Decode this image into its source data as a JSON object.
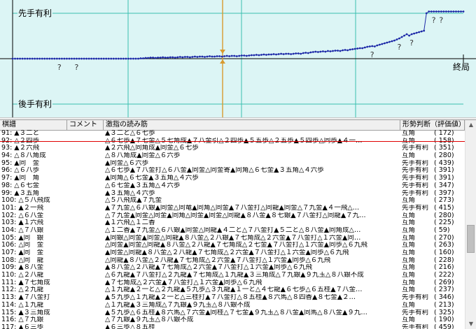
{
  "graph": {
    "label_top": "先手有利",
    "label_bottom": "後手有利",
    "label_end": "終局",
    "question_mark": "?",
    "grid_color": "#3ac0b0",
    "cursor_color": "#d89a30",
    "line_color": "#1e2aa8",
    "zero_line_color": "#000000",
    "background": "#dcf5f5",
    "eval_series": [
      0,
      0,
      0,
      0,
      0,
      0,
      0,
      0,
      0,
      0,
      0,
      0,
      0,
      0,
      0,
      0,
      0,
      0,
      0,
      0,
      0,
      0,
      0,
      0,
      0,
      0,
      0,
      0,
      0,
      0,
      0,
      0,
      0,
      0,
      0,
      0,
      0,
      0,
      0,
      0,
      0,
      0,
      0,
      0,
      0,
      0,
      0,
      0,
      0,
      0,
      0,
      0,
      1,
      1,
      2,
      2,
      3,
      3,
      2,
      3,
      3,
      4,
      3,
      3,
      4,
      4,
      3,
      4,
      5,
      4,
      5,
      5,
      4,
      5,
      6,
      5,
      6,
      6,
      5,
      6,
      7,
      6,
      6,
      7,
      7,
      6,
      7,
      8,
      7,
      8,
      8,
      7,
      8,
      9,
      9,
      8,
      9,
      10,
      10,
      11,
      10,
      11,
      12,
      11,
      12,
      12,
      13,
      12,
      13,
      14,
      13,
      14,
      14,
      13,
      14,
      15,
      15,
      14,
      16,
      17,
      16,
      18,
      19,
      20,
      19,
      20,
      21,
      20,
      22,
      21,
      22,
      23,
      23,
      22,
      24,
      25,
      24,
      26,
      27,
      28,
      29,
      30,
      30,
      32,
      34,
      35,
      36,
      35,
      38,
      40,
      42,
      44,
      46,
      48,
      50,
      52,
      55,
      58,
      62,
      66,
      70,
      66,
      70,
      72,
      74,
      76,
      78,
      80,
      130,
      135,
      135,
      135,
      135,
      135,
      135,
      135,
      135,
      135,
      135,
      135,
      135,
      135,
      135,
      135
    ],
    "question_marks_at": [
      19,
      26,
      146,
      157,
      162,
      171,
      174
    ]
  },
  "list": {
    "headers": [
      "棋譜",
      "コメント",
      "激指の読み筋",
      "形勢判断（評価値）"
    ],
    "rows": [
      {
        "move": "91: ▲３二と",
        "pv": "▲３二と△６七歩",
        "judge": "互角",
        "val": "(    172)"
      },
      {
        "move": "92: △２四歩",
        "pv": "△６七歩▲７七金△５七角成▲７八金引△２四歩▲５五歩△２五歩▲５四歩△同歩▲４一…",
        "judge": "互角",
        "val": "(    158)"
      },
      {
        "move": "93: ▲２六飛",
        "pv": "▲２六飛△同角成▲同金△６七歩",
        "judge": "先手有利",
        "val": "(    351)"
      },
      {
        "move": "94: △８八角成",
        "pv": "△８八角成▲同金△６六歩",
        "judge": "互角",
        "val": "(    280)"
      },
      {
        "move": "95: ▲同　金",
        "pv": "▲同金△６六歩",
        "judge": "先手有利",
        "val": "(    439)"
      },
      {
        "move": "96: △６八歩",
        "pv": "△６七歩▲７八金打△６八金▲同金△同金寄▲同角△６七金▲３五角△４六歩",
        "judge": "先手有利",
        "val": "(    391)"
      },
      {
        "move": "97: ▲同　角",
        "pv": "▲同角△６七金▲３五角△４六歩",
        "judge": "先手有利",
        "val": "(    391)"
      },
      {
        "move": "98: △６七金",
        "pv": "△６七金▲３五角△４六歩",
        "judge": "先手有利",
        "val": "(    347)"
      },
      {
        "move": "99: ▲３五角",
        "pv": "▲３五角△４六歩",
        "judge": "先手有利",
        "val": "(    397)"
      },
      {
        "move": "100: △５八飛成",
        "pv": "△５八飛成▲７九金",
        "judge": "互角",
        "val": "(    273)"
      },
      {
        "move": "101: ▲２一飛",
        "pv": "▲７九金△６八銀▲同金△同竜▲同角△同金▲７八金打△同龍▲同金△７九金▲４一飛△…",
        "judge": "先手有利",
        "val": "(    415)"
      },
      {
        "move": "102: △６八金",
        "pv": "△７九金▲同金△同金▲同角△同金▲同金△同龍▲８八金▲８七銀▲７八金打△同龍▲７九…",
        "judge": "互角",
        "val": "(    280)"
      },
      {
        "move": "103: ▲１六飛",
        "pv": "▲１六飛△１二香",
        "judge": "互角",
        "val": "(    225)"
      },
      {
        "move": "104: △７八銀",
        "pv": "△１二香▲７九金△６八銀▲同金△同龍▲４二と△７八金打▲５二と△８八金▲同角成△…",
        "judge": "互角",
        "val": "(     59)"
      },
      {
        "move": "105: ▲同　銀",
        "pv": "▲同銀△同金▲同金△同龍▲８八金△２八銀▲７七角成△２六金▲７八金打△１六金▲同…",
        "judge": "互角",
        "val": "(    270)"
      },
      {
        "move": "106: △同　金",
        "pv": "△同金▲同金△同龍▲８八金△２八龍▲７七角成△２七金▲７八金打△１六金▲同歩△６九飛",
        "judge": "互角",
        "val": "(    263)"
      },
      {
        "move": "107: ▲同　金",
        "pv": "▲同金△同龍▲８八金△２八龍▲７七角成△２六金▲７八金打△１六金▲同歩△６九飛",
        "judge": "互角",
        "val": "(    160)"
      },
      {
        "move": "108: △同　龍",
        "pv": "△同龍▲８八金△２八龍▲７七角成△２六金▲７八金打△１六金▲同歩△６九飛",
        "judge": "互角",
        "val": "(    228)"
      },
      {
        "move": "109: ▲８八金",
        "pv": "▲８八金△２八龍▲７七角成△２六金▲７八金打△１六金▲同歩△６九飛",
        "judge": "互角",
        "val": "(    216)"
      },
      {
        "move": "110: △２八龍",
        "pv": "△６九龍▲７八金打△２九龍▲７七角成△１九龍▲３三角成△７九銀▲９九玉△８八銀不成",
        "judge": "互角",
        "val": "(    222)"
      },
      {
        "move": "111: ▲７七角成",
        "pv": "▲７七角成△２六金▲７八金打△１六金▲同歩△６九飛",
        "judge": "互角",
        "val": "(    269)"
      },
      {
        "move": "112: △２九龍",
        "pv": "△１九龍▲２一と△２九龍▲５九歩△３九龍▲１一と△４七龍▲６七歩△６五桂▲７八金…",
        "judge": "互角",
        "val": "(    237)"
      },
      {
        "move": "113: ▲７八金打",
        "pv": "▲５九歩△１九龍▲２一と△三桂打▲７八金打△８五桂▲８六馬△８四香▲８七金▲２…",
        "judge": "先手有利",
        "val": "(    346)"
      },
      {
        "move": "114: △１九龍",
        "pv": "△１九龍▲３三角成△７九銀▲９九玉△８八銀不成",
        "judge": "互角",
        "val": "(    213)"
      },
      {
        "move": "115: ▲３三角成",
        "pv": "▲５九歩△６五桂▲８六馬△７六金▲同桂△７七金▲９九玉△８八金▲同馬△８八金▲９九…",
        "judge": "先手有利",
        "val": "(    325)"
      },
      {
        "move": "116: △７九銀",
        "pv": "△７九銀▲９九玉△８八銀不成",
        "judge": "互角",
        "val": "(    190)"
      },
      {
        "move": "117: ▲６三歩",
        "pv": "▲６三歩△８五桂",
        "judge": "先手有利",
        "val": "(    459)"
      }
    ]
  }
}
